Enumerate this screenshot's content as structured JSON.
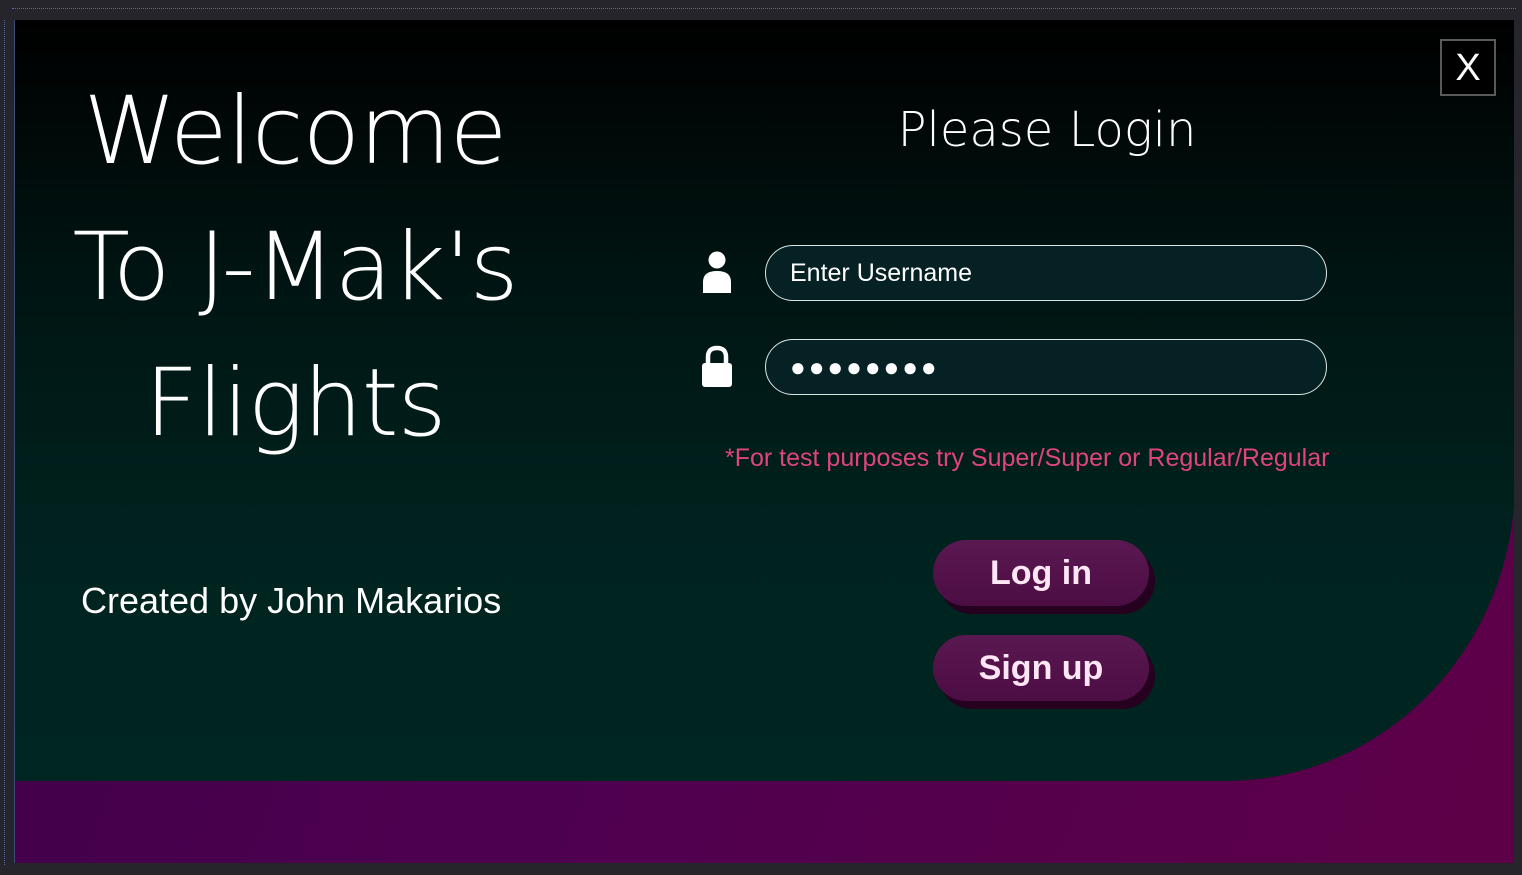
{
  "welcome": {
    "line1": "Welcome",
    "line2": "To J-Mak's",
    "line3": "Flights"
  },
  "credit": "Created by John Makarios",
  "login": {
    "title": "Please Login",
    "username_placeholder": "Enter Username",
    "username_icon": "user-icon",
    "password_value": "●●●●●●●●",
    "password_icon": "lock-icon",
    "test_note": "*For test purposes try Super/Super or Regular/Regular",
    "login_label": "Log in",
    "signup_label": "Sign up"
  },
  "close_label": "X",
  "colors": {
    "note": "#e0457a",
    "button": "#5a1850",
    "accent": "#5e0048",
    "panel": "#002622"
  }
}
